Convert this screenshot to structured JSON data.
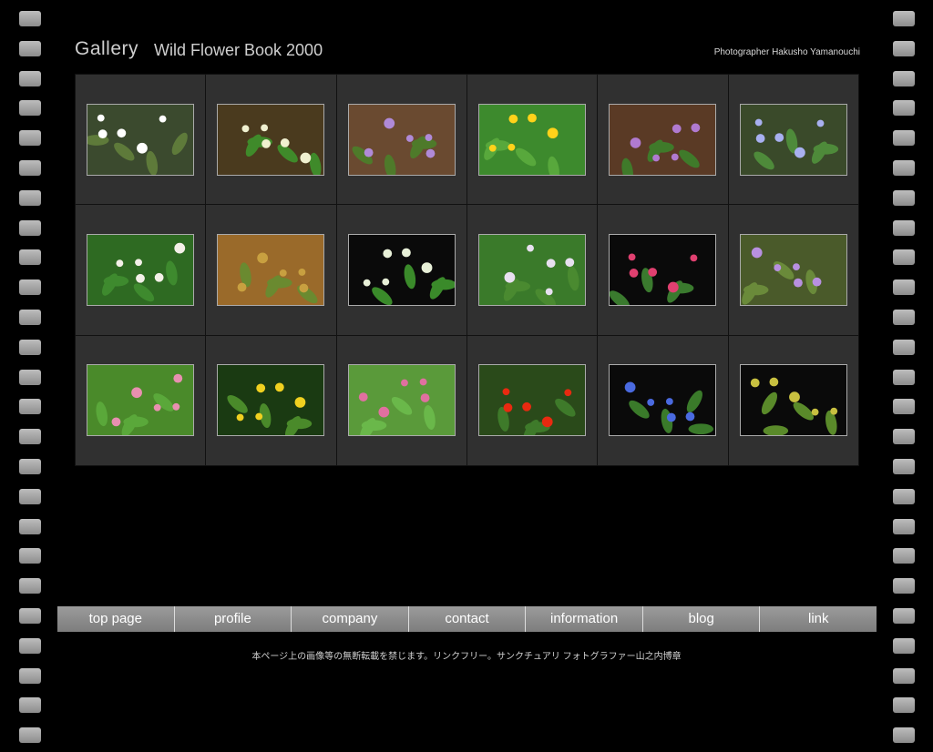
{
  "header": {
    "gallery": "Gallery",
    "book_title": "Wild Flower Book 2000",
    "photographer": "Photographer Hakusho Yamanouchi"
  },
  "thumbnails": [
    {
      "name": "white-anemone-flowers",
      "bg": "#3b4a2e",
      "flower": "#ffffff",
      "leaf": "#5e7a3a"
    },
    {
      "name": "green-leaf-flower",
      "bg": "#4a3a1e",
      "flower": "#f0f0d0",
      "leaf": "#3f8a2a"
    },
    {
      "name": "purple-violets",
      "bg": "#6a4a30",
      "flower": "#b08ad8",
      "leaf": "#4e7a2a"
    },
    {
      "name": "yellow-dandelions",
      "bg": "#3d8a2d",
      "flower": "#ffd21a",
      "leaf": "#58a83c"
    },
    {
      "name": "purple-violet-leaf",
      "bg": "#5a3a25",
      "flower": "#b07ad0",
      "leaf": "#3f7a2a"
    },
    {
      "name": "blue-small-flowers",
      "bg": "#3a4a2a",
      "flower": "#a8b0f0",
      "leaf": "#4e8a3a"
    },
    {
      "name": "white-star-flowers",
      "bg": "#2e6a22",
      "flower": "#f4f0e8",
      "leaf": "#3e8a2e"
    },
    {
      "name": "orange-grass-orchid",
      "bg": "#9a6a2a",
      "flower": "#c8a040",
      "leaf": "#6a8a30"
    },
    {
      "name": "three-leaf-flower",
      "bg": "#0a0a0a",
      "flower": "#e8f0d8",
      "leaf": "#3a8a2a"
    },
    {
      "name": "white-lily",
      "bg": "#3a7a2a",
      "flower": "#e8e0f0",
      "leaf": "#4a8a30"
    },
    {
      "name": "pink-flower-dark",
      "bg": "#0a0a0a",
      "flower": "#e04070",
      "leaf": "#3a7a2e"
    },
    {
      "name": "purple-daisies",
      "bg": "#4a5a2a",
      "flower": "#b890e0",
      "leaf": "#6a8a3a"
    },
    {
      "name": "pink-spikes",
      "bg": "#4a8a2a",
      "flower": "#e890b0",
      "leaf": "#5aa83a"
    },
    {
      "name": "yellow-flowers",
      "bg": "#1a3a12",
      "flower": "#f0d020",
      "leaf": "#4a8a2a"
    },
    {
      "name": "pink-spikes-2",
      "bg": "#5a9a3a",
      "flower": "#e070a0",
      "leaf": "#6ab84a"
    },
    {
      "name": "red-spider-lilies",
      "bg": "#2a4a1a",
      "flower": "#e82a10",
      "leaf": "#3e7a2a"
    },
    {
      "name": "blue-dayflower",
      "bg": "#0a0a0a",
      "flower": "#4a6ae0",
      "leaf": "#3a7a2a"
    },
    {
      "name": "yellow-grass",
      "bg": "#0a0a0a",
      "flower": "#c8c040",
      "leaf": "#5a8a2a"
    }
  ],
  "nav": [
    {
      "label": "top page"
    },
    {
      "label": "profile"
    },
    {
      "label": "company"
    },
    {
      "label": "contact"
    },
    {
      "label": "information"
    },
    {
      "label": "blog"
    },
    {
      "label": "link"
    }
  ],
  "footer": {
    "text": "本ページ上の画像等の無断転載を禁じます。リンクフリー。サンクチュアリ フォトグラファー山之内博章"
  }
}
